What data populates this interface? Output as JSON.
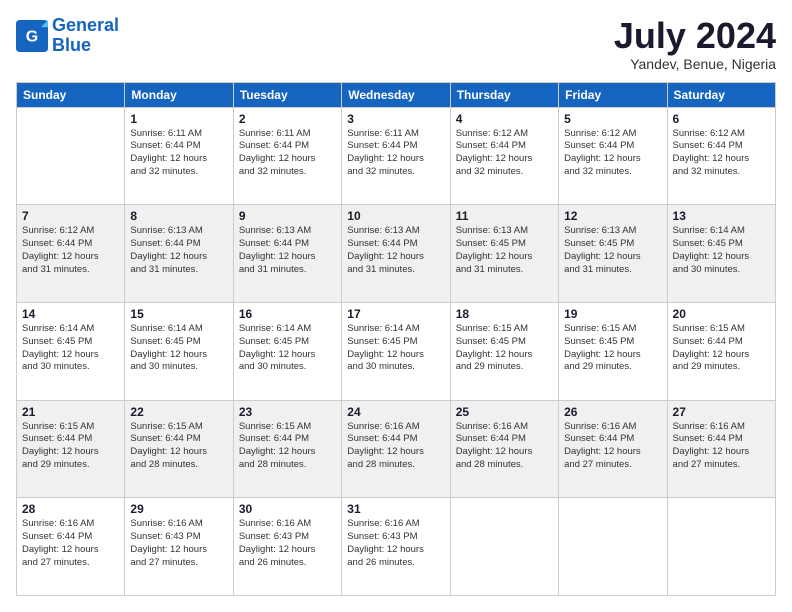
{
  "header": {
    "logo_line1": "General",
    "logo_line2": "Blue",
    "month_title": "July 2024",
    "location": "Yandev, Benue, Nigeria"
  },
  "weekdays": [
    "Sunday",
    "Monday",
    "Tuesday",
    "Wednesday",
    "Thursday",
    "Friday",
    "Saturday"
  ],
  "weeks": [
    {
      "shade": "white",
      "days": [
        {
          "day": "",
          "info": ""
        },
        {
          "day": "1",
          "info": "Sunrise: 6:11 AM\nSunset: 6:44 PM\nDaylight: 12 hours\nand 32 minutes."
        },
        {
          "day": "2",
          "info": "Sunrise: 6:11 AM\nSunset: 6:44 PM\nDaylight: 12 hours\nand 32 minutes."
        },
        {
          "day": "3",
          "info": "Sunrise: 6:11 AM\nSunset: 6:44 PM\nDaylight: 12 hours\nand 32 minutes."
        },
        {
          "day": "4",
          "info": "Sunrise: 6:12 AM\nSunset: 6:44 PM\nDaylight: 12 hours\nand 32 minutes."
        },
        {
          "day": "5",
          "info": "Sunrise: 6:12 AM\nSunset: 6:44 PM\nDaylight: 12 hours\nand 32 minutes."
        },
        {
          "day": "6",
          "info": "Sunrise: 6:12 AM\nSunset: 6:44 PM\nDaylight: 12 hours\nand 32 minutes."
        }
      ]
    },
    {
      "shade": "shaded",
      "days": [
        {
          "day": "7",
          "info": "Sunrise: 6:12 AM\nSunset: 6:44 PM\nDaylight: 12 hours\nand 31 minutes."
        },
        {
          "day": "8",
          "info": "Sunrise: 6:13 AM\nSunset: 6:44 PM\nDaylight: 12 hours\nand 31 minutes."
        },
        {
          "day": "9",
          "info": "Sunrise: 6:13 AM\nSunset: 6:44 PM\nDaylight: 12 hours\nand 31 minutes."
        },
        {
          "day": "10",
          "info": "Sunrise: 6:13 AM\nSunset: 6:44 PM\nDaylight: 12 hours\nand 31 minutes."
        },
        {
          "day": "11",
          "info": "Sunrise: 6:13 AM\nSunset: 6:45 PM\nDaylight: 12 hours\nand 31 minutes."
        },
        {
          "day": "12",
          "info": "Sunrise: 6:13 AM\nSunset: 6:45 PM\nDaylight: 12 hours\nand 31 minutes."
        },
        {
          "day": "13",
          "info": "Sunrise: 6:14 AM\nSunset: 6:45 PM\nDaylight: 12 hours\nand 30 minutes."
        }
      ]
    },
    {
      "shade": "white",
      "days": [
        {
          "day": "14",
          "info": "Sunrise: 6:14 AM\nSunset: 6:45 PM\nDaylight: 12 hours\nand 30 minutes."
        },
        {
          "day": "15",
          "info": "Sunrise: 6:14 AM\nSunset: 6:45 PM\nDaylight: 12 hours\nand 30 minutes."
        },
        {
          "day": "16",
          "info": "Sunrise: 6:14 AM\nSunset: 6:45 PM\nDaylight: 12 hours\nand 30 minutes."
        },
        {
          "day": "17",
          "info": "Sunrise: 6:14 AM\nSunset: 6:45 PM\nDaylight: 12 hours\nand 30 minutes."
        },
        {
          "day": "18",
          "info": "Sunrise: 6:15 AM\nSunset: 6:45 PM\nDaylight: 12 hours\nand 29 minutes."
        },
        {
          "day": "19",
          "info": "Sunrise: 6:15 AM\nSunset: 6:45 PM\nDaylight: 12 hours\nand 29 minutes."
        },
        {
          "day": "20",
          "info": "Sunrise: 6:15 AM\nSunset: 6:44 PM\nDaylight: 12 hours\nand 29 minutes."
        }
      ]
    },
    {
      "shade": "shaded",
      "days": [
        {
          "day": "21",
          "info": "Sunrise: 6:15 AM\nSunset: 6:44 PM\nDaylight: 12 hours\nand 29 minutes."
        },
        {
          "day": "22",
          "info": "Sunrise: 6:15 AM\nSunset: 6:44 PM\nDaylight: 12 hours\nand 28 minutes."
        },
        {
          "day": "23",
          "info": "Sunrise: 6:15 AM\nSunset: 6:44 PM\nDaylight: 12 hours\nand 28 minutes."
        },
        {
          "day": "24",
          "info": "Sunrise: 6:16 AM\nSunset: 6:44 PM\nDaylight: 12 hours\nand 28 minutes."
        },
        {
          "day": "25",
          "info": "Sunrise: 6:16 AM\nSunset: 6:44 PM\nDaylight: 12 hours\nand 28 minutes."
        },
        {
          "day": "26",
          "info": "Sunrise: 6:16 AM\nSunset: 6:44 PM\nDaylight: 12 hours\nand 27 minutes."
        },
        {
          "day": "27",
          "info": "Sunrise: 6:16 AM\nSunset: 6:44 PM\nDaylight: 12 hours\nand 27 minutes."
        }
      ]
    },
    {
      "shade": "white",
      "days": [
        {
          "day": "28",
          "info": "Sunrise: 6:16 AM\nSunset: 6:44 PM\nDaylight: 12 hours\nand 27 minutes."
        },
        {
          "day": "29",
          "info": "Sunrise: 6:16 AM\nSunset: 6:43 PM\nDaylight: 12 hours\nand 27 minutes."
        },
        {
          "day": "30",
          "info": "Sunrise: 6:16 AM\nSunset: 6:43 PM\nDaylight: 12 hours\nand 26 minutes."
        },
        {
          "day": "31",
          "info": "Sunrise: 6:16 AM\nSunset: 6:43 PM\nDaylight: 12 hours\nand 26 minutes."
        },
        {
          "day": "",
          "info": ""
        },
        {
          "day": "",
          "info": ""
        },
        {
          "day": "",
          "info": ""
        }
      ]
    }
  ]
}
